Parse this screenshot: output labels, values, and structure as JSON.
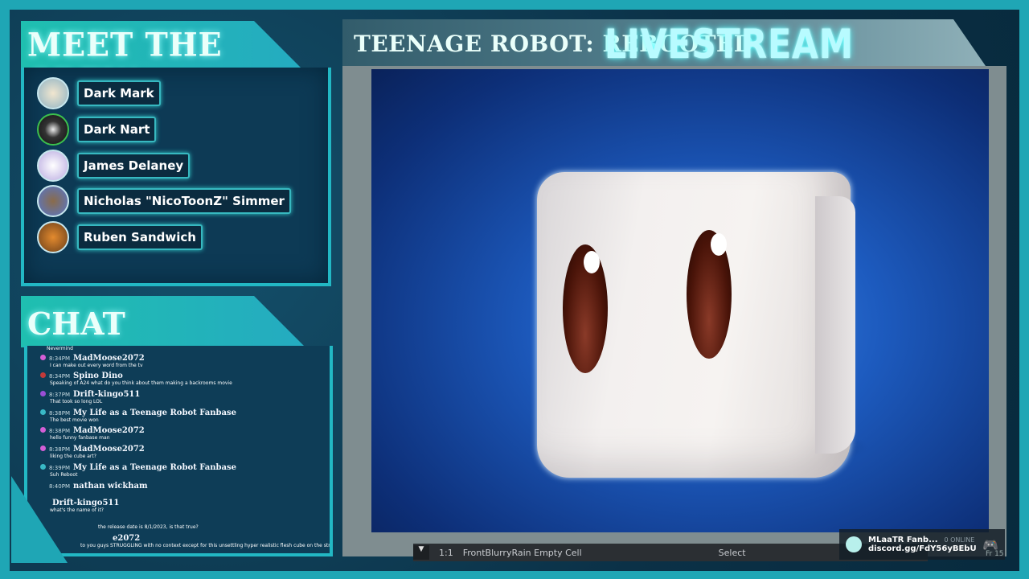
{
  "crew": {
    "title": "MEET THE CREW",
    "members": [
      {
        "name": "Dark Mark"
      },
      {
        "name": "Dark Nart"
      },
      {
        "name": "James Delaney"
      },
      {
        "name": "Nicholas \"NicoToonZ\" Simmer"
      },
      {
        "name": "Ruben Sandwich"
      }
    ]
  },
  "chat": {
    "title": "CHAT",
    "top_text": "Nevermind",
    "messages": [
      {
        "time": "8:34PM",
        "user": "MadMoose2072",
        "text": "I can make out every word from the tv"
      },
      {
        "time": "8:34PM",
        "user": "Spino Dino",
        "text": "Speaking of A24 what do you think about them making a backrooms movie"
      },
      {
        "time": "8:37PM",
        "user": "Drift-kingo511",
        "text": "That took so long LOL"
      },
      {
        "time": "8:38PM",
        "user": "My Life as a Teenage Robot Fanbase",
        "text": "The best movie won"
      },
      {
        "time": "8:38PM",
        "user": "MadMoose2072",
        "text": "hello funny fanbase man"
      },
      {
        "time": "8:38PM",
        "user": "MadMoose2072",
        "text": "liking the cube art?"
      },
      {
        "time": "8:39PM",
        "user": "My Life as a Teenage Robot Fanbase",
        "text": "Suh Reboot"
      },
      {
        "time": "8:40PM",
        "user": "nathan wickham",
        "text": ""
      },
      {
        "time": "",
        "user": "Drift-kingo511",
        "text": "what's the name of it?"
      },
      {
        "time": "",
        "user": "",
        "text": "the release date is 8/1/2023, is that true?"
      },
      {
        "time": "",
        "user": "e2072",
        "text": "to you guys STRUGGLING with no context except for this unsettling hyper realistic flesh cube on the stream"
      }
    ]
  },
  "stream": {
    "title": "TEENAGE ROBOT: REBOOTED",
    "live_label": "LIVESTREAM"
  },
  "editor": {
    "zoom": "1:1",
    "layer": "FrontBlurryRain Empty Cell",
    "tool": "Select",
    "fr": "Fr 15"
  },
  "discord": {
    "server": "MLaaTR Fanb...",
    "link": "discord.gg/FdY56yBEbU",
    "online": "0 ONLINE"
  }
}
